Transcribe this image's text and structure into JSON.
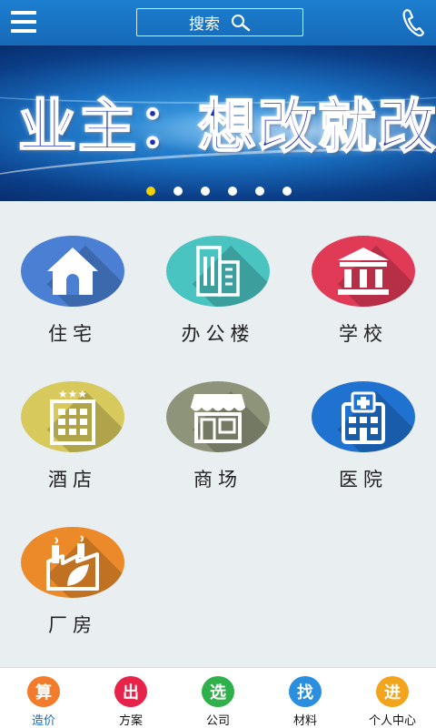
{
  "header": {
    "menu_icon": "menu-icon",
    "search_label": "搜索",
    "search_icon": "search-icon",
    "phone_icon": "phone-icon",
    "color": "#1a74c4"
  },
  "banner": {
    "title": "业主：想改就改",
    "slide_count": 6,
    "active_slide": 1
  },
  "categories": [
    {
      "label": "住宅",
      "icon": "house-icon",
      "color": "#4a7fd4"
    },
    {
      "label": "办公楼",
      "icon": "office-building-icon",
      "color": "#49c4c0"
    },
    {
      "label": "学校",
      "icon": "school-icon",
      "color": "#e03a57"
    },
    {
      "label": "酒店",
      "icon": "hotel-icon",
      "color": "#d7c95c"
    },
    {
      "label": "商场",
      "icon": "mall-icon",
      "color": "#8e9479"
    },
    {
      "label": "医院",
      "icon": "hospital-icon",
      "color": "#1f72d0"
    },
    {
      "label": "厂房",
      "icon": "factory-icon",
      "color": "#ec8a2a"
    }
  ],
  "bottom_nav": [
    {
      "glyph": "算",
      "label": "造价",
      "color": "#f27c2b",
      "active": true
    },
    {
      "glyph": "出",
      "label": "方案",
      "color": "#e8234a",
      "active": false
    },
    {
      "glyph": "选",
      "label": "公司",
      "color": "#2fb04a",
      "active": false
    },
    {
      "glyph": "找",
      "label": "材料",
      "color": "#2a8fde",
      "active": false
    },
    {
      "glyph": "进",
      "label": "个人中心",
      "color": "#f2a51c",
      "active": false
    }
  ]
}
